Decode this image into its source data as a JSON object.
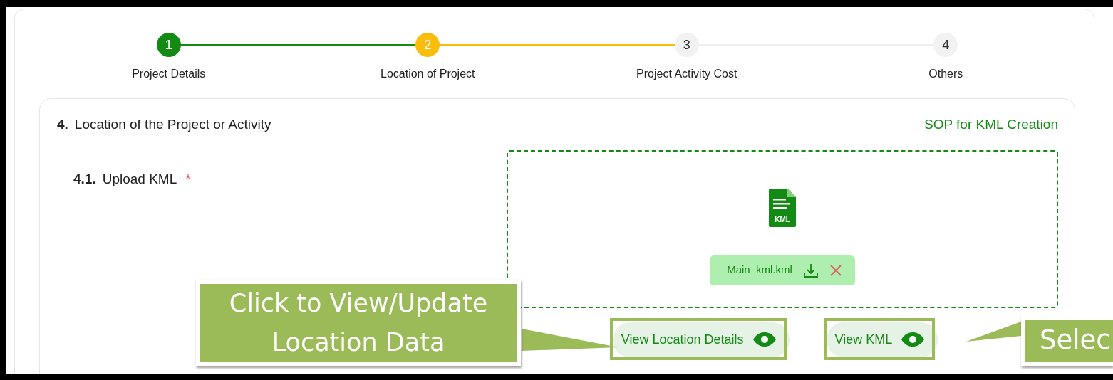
{
  "stepper": {
    "steps": [
      {
        "number": "1",
        "label": "Project Details",
        "kind": "done"
      },
      {
        "number": "2",
        "label": "Location of Project",
        "kind": "current"
      },
      {
        "number": "3",
        "label": "Project Activity Cost",
        "kind": "pending"
      },
      {
        "number": "4",
        "label": "Others",
        "kind": "pending"
      }
    ]
  },
  "section": {
    "number": "4.",
    "title": "Location of the Project or Activity",
    "link": "SOP for KML Creation"
  },
  "field": {
    "number": "4.1.",
    "label": "Upload KML",
    "required_mark": "*"
  },
  "upload": {
    "file_badge": "KML",
    "file": {
      "name": "Main_kml.kml"
    }
  },
  "buttons": [
    {
      "label": "View Location Details",
      "highlighted": true
    },
    {
      "label": "View KML",
      "highlighted": true
    }
  ],
  "callouts": [
    {
      "text": "Click to View/Update Location Data",
      "kind": "left"
    },
    {
      "text": "Selec",
      "kind": "right"
    }
  ]
}
